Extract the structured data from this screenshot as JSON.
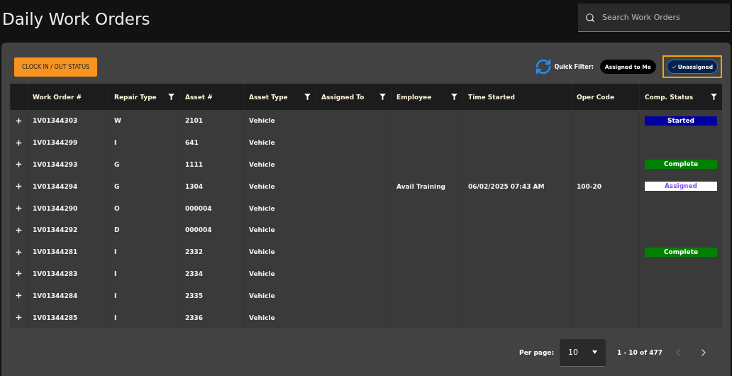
{
  "page": {
    "title": "Daily Work Orders"
  },
  "search": {
    "placeholder": "Search Work Orders"
  },
  "toolbar": {
    "clock_button": "CLOCK IN / OUT STATUS",
    "quick_filter_label": "Quick Filter:",
    "quick_filters": [
      {
        "label": "Assigned to Me",
        "selected": false
      },
      {
        "label": "Unassigned",
        "selected": true
      }
    ]
  },
  "table": {
    "columns": [
      {
        "label": "Work Order #",
        "filter": false
      },
      {
        "label": "Repair Type",
        "filter": true
      },
      {
        "label": "Asset #",
        "filter": false
      },
      {
        "label": "Asset Type",
        "filter": true
      },
      {
        "label": "Assigned To",
        "filter": true
      },
      {
        "label": "Employee",
        "filter": true
      },
      {
        "label": "Time Started",
        "filter": false
      },
      {
        "label": "Oper Code",
        "filter": false
      },
      {
        "label": "Comp. Status",
        "filter": true
      }
    ],
    "rows": [
      {
        "cells": [
          "1V01344303",
          "W",
          "2101",
          "Vehicle",
          "",
          "",
          "",
          "",
          ""
        ],
        "status": {
          "label": "Started",
          "kind": "started"
        }
      },
      {
        "cells": [
          "1V01344299",
          "I",
          "641",
          "Vehicle",
          "",
          "",
          "",
          "",
          ""
        ]
      },
      {
        "cells": [
          "1V01344293",
          "G",
          "1111",
          "Vehicle",
          "",
          "",
          "",
          "",
          ""
        ],
        "status": {
          "label": "Complete",
          "kind": "complete"
        }
      },
      {
        "cells": [
          "1V01344294",
          "G",
          "1304",
          "Vehicle",
          "",
          "Avail Training",
          "06/02/2025 07:43 AM",
          "100-20",
          ""
        ],
        "status": {
          "label": "Assigned",
          "kind": "assigned"
        }
      },
      {
        "cells": [
          "1V01344290",
          "O",
          "000004",
          "Vehicle",
          "",
          "",
          "",
          "",
          ""
        ]
      },
      {
        "cells": [
          "1V01344292",
          "D",
          "000004",
          "Vehicle",
          "",
          "",
          "",
          "",
          ""
        ]
      },
      {
        "cells": [
          "1V01344281",
          "I",
          "2332",
          "Vehicle",
          "",
          "",
          "",
          "",
          ""
        ],
        "status": {
          "label": "Complete",
          "kind": "complete"
        }
      },
      {
        "cells": [
          "1V01344283",
          "I",
          "2334",
          "Vehicle",
          "",
          "",
          "",
          "",
          ""
        ]
      },
      {
        "cells": [
          "1V01344284",
          "I",
          "2335",
          "Vehicle",
          "",
          "",
          "",
          "",
          ""
        ]
      },
      {
        "cells": [
          "1V01344285",
          "I",
          "2336",
          "Vehicle",
          "",
          "",
          "",
          "",
          ""
        ]
      }
    ]
  },
  "pagination": {
    "per_page_label": "Per page:",
    "per_page": "10",
    "range": "1 - 10 of 477"
  }
}
